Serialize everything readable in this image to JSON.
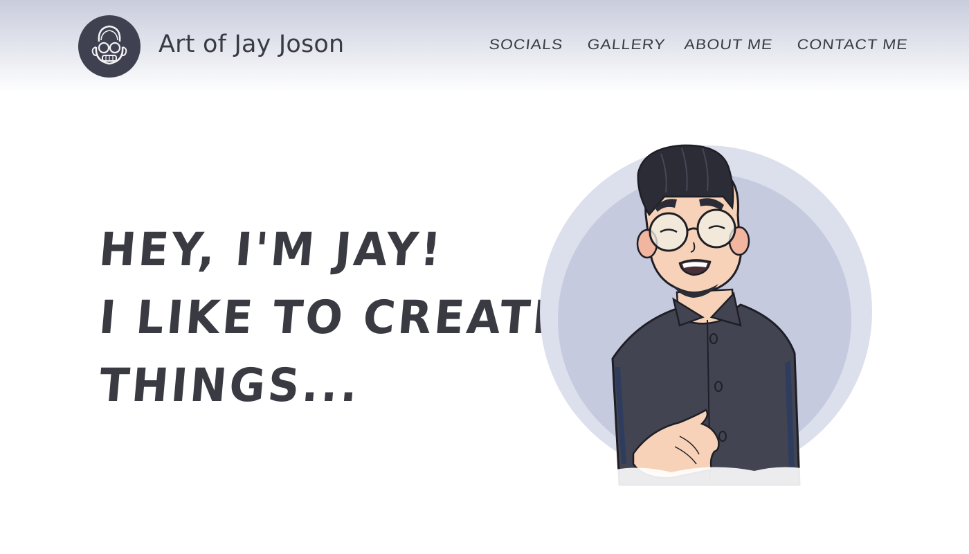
{
  "header": {
    "logo_icon": "cartoon-face-logo-icon",
    "site_title": "Art of Jay Joson",
    "nav": [
      {
        "label": "SOCIALS"
      },
      {
        "label": "GALLERY"
      },
      {
        "label": "ABOUT ME"
      },
      {
        "label": "CONTACT ME"
      }
    ]
  },
  "hero": {
    "lines": [
      "HEY, I'M JAY!",
      "I LIKE TO CREATE",
      "THINGS..."
    ],
    "illustration": "cartoon-self-portrait-illustration"
  },
  "colors": {
    "text": "#3a3b42",
    "header_gradient_top": "#c9ccdc",
    "circle_outer": "#dcdfec",
    "circle_inner": "#c6cade",
    "shirt": "#434452",
    "skin": "#f7d2b8"
  }
}
